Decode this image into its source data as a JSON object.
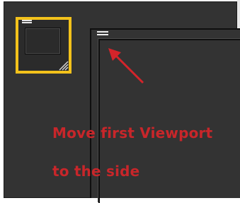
{
  "annotation": {
    "line1": "Move first Viewport",
    "line2": "to the side"
  },
  "colors": {
    "highlight": "#f3c21b",
    "annotation": "#c8262a",
    "background": "#333333"
  },
  "icons": {
    "thumbnail_menu": "hamburger-icon",
    "thumbnail_resize": "resize-grip-icon",
    "viewport_menu": "hamburger-icon",
    "pointer": "arrow-icon"
  }
}
